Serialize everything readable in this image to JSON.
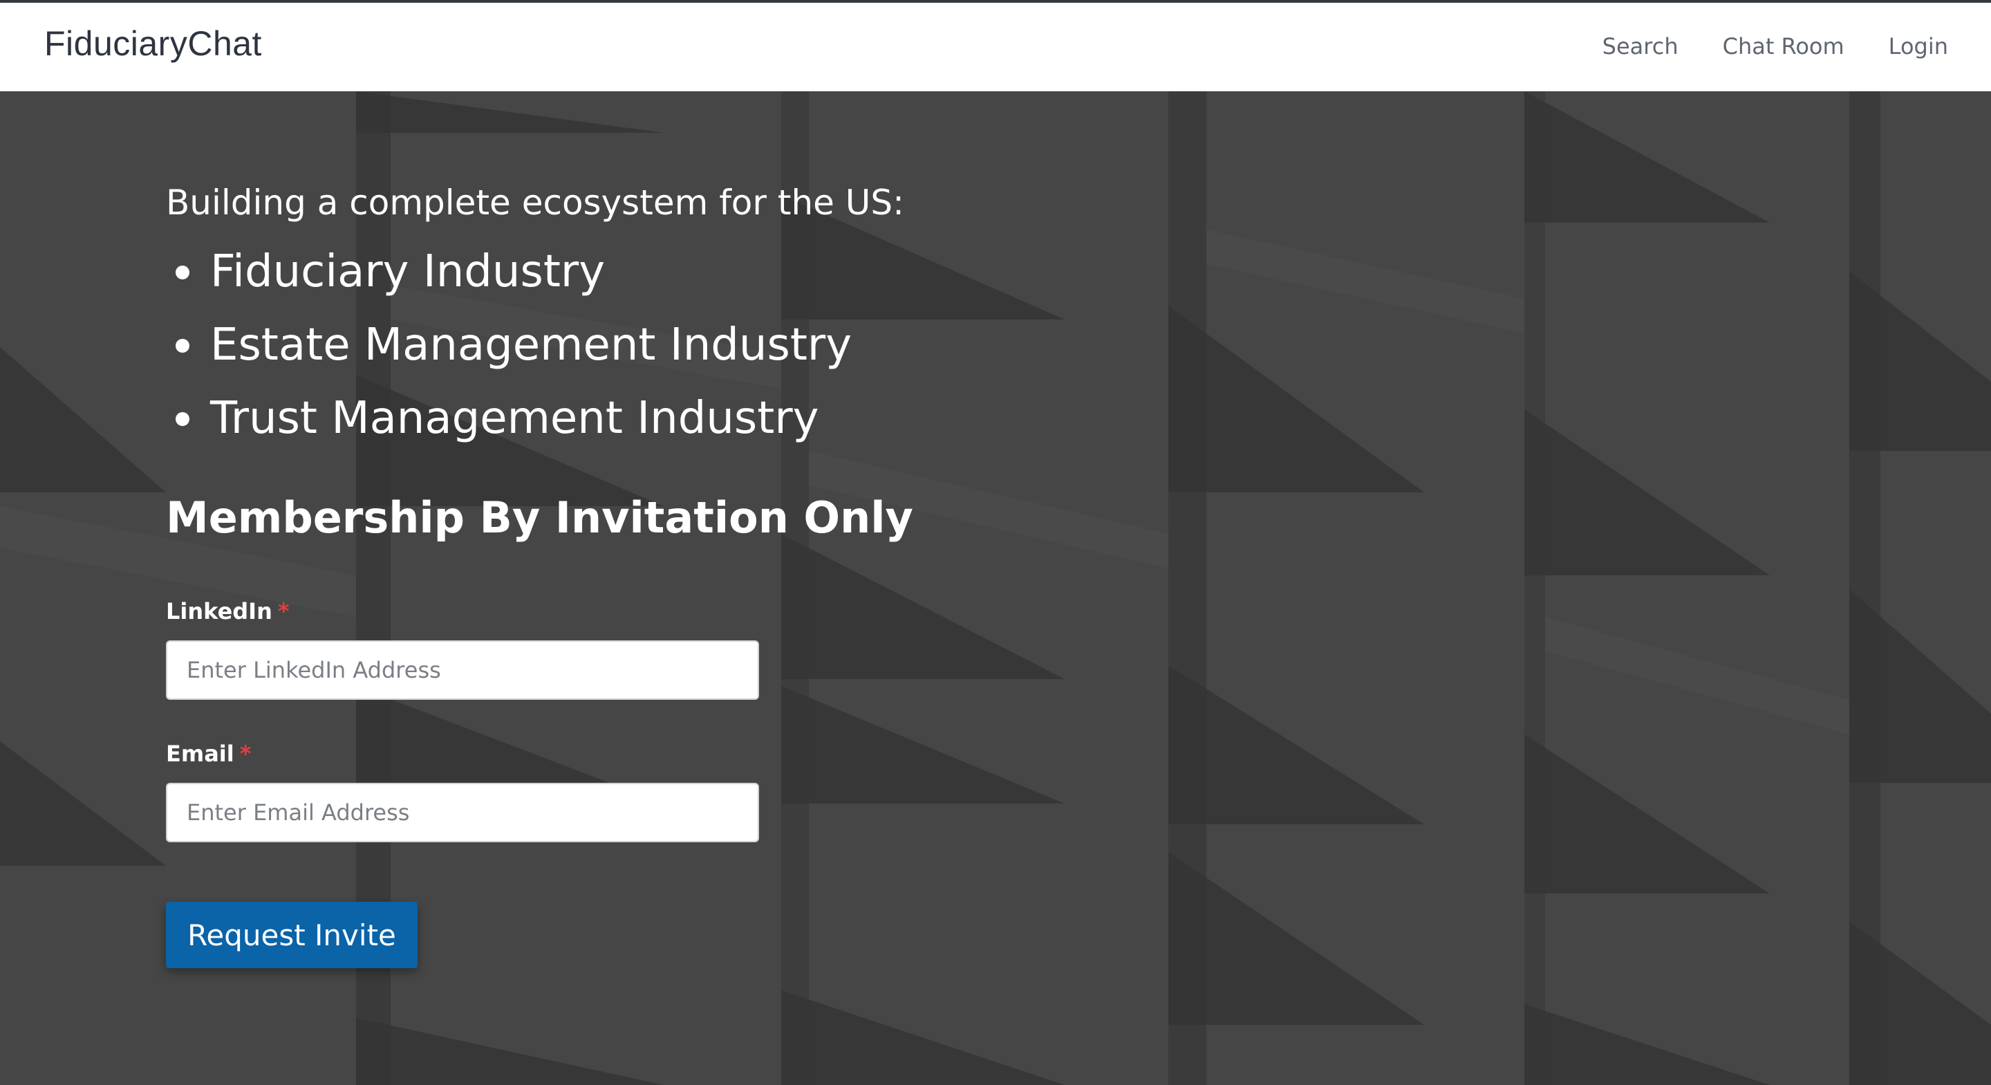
{
  "navbar": {
    "brand": "FiduciaryChat",
    "links": [
      {
        "label": "Search"
      },
      {
        "label": "Chat Room"
      },
      {
        "label": "Login"
      }
    ]
  },
  "hero": {
    "intro": "Building a complete ecosystem for the US:",
    "industries": [
      "Fiduciary Industry",
      "Estate Management Industry",
      "Trust Management Industry"
    ],
    "title": "Membership By Invitation Only",
    "form": {
      "linkedin": {
        "label": "LinkedIn",
        "required_mark": "*",
        "placeholder": "Enter LinkedIn Address",
        "value": ""
      },
      "email": {
        "label": "Email",
        "required_mark": "*",
        "placeholder": "Enter Email Address",
        "value": ""
      },
      "submit_label": "Request Invite"
    }
  },
  "colors": {
    "navbar_bg": "#ffffff",
    "hero_bg": "#454545",
    "accent_button": "#0b63a8",
    "required_star": "#e0413b"
  }
}
